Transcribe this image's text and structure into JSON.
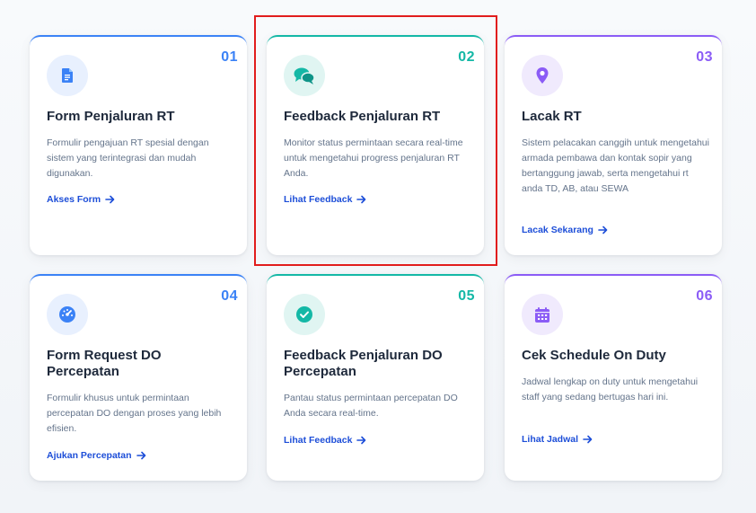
{
  "cards": [
    {
      "number": "01",
      "icon": "document-icon",
      "title": "Form Penjaluran RT",
      "description": "Formulir pengajuan RT spesial dengan sistem yang terintegrasi dan mudah digunakan.",
      "link": "Akses Form",
      "accent": "#3b82f6"
    },
    {
      "number": "02",
      "icon": "chat-bubbles-icon",
      "title": "Feedback Penjaluran RT",
      "description": "Monitor status permintaan secara real-time untuk mengetahui progress penjaluran RT Anda.",
      "link": "Lihat Feedback",
      "accent": "#14b8a6"
    },
    {
      "number": "03",
      "icon": "map-pin-icon",
      "title": "Lacak RT",
      "description": "Sistem pelacakan canggih untuk mengetahui armada pembawa dan kontak sopir yang bertanggung jawab, serta mengetahui rt anda TD, AB, atau SEWA",
      "link": "Lacak Sekarang",
      "accent": "#8b5cf6"
    },
    {
      "number": "04",
      "icon": "speedometer-icon",
      "title": "Form Request DO Percepatan",
      "description": "Formulir khusus untuk permintaan percepatan DO dengan proses yang lebih efisien.",
      "link": "Ajukan Percepatan",
      "accent": "#3b82f6"
    },
    {
      "number": "05",
      "icon": "check-circle-icon",
      "title": "Feedback Penjaluran DO Percepatan",
      "description": "Pantau status permintaan percepatan DO Anda secara real-time.",
      "link": "Lihat Feedback",
      "accent": "#14b8a6"
    },
    {
      "number": "06",
      "icon": "calendar-icon",
      "title": "Cek Schedule On Duty",
      "description": "Jadwal lengkap on duty untuk mengetahui staff yang sedang bertugas hari ini.",
      "link": "Lihat Jadwal",
      "accent": "#8b5cf6"
    }
  ],
  "link_color": "#1d4ed8",
  "highlight_color": "#e11d1d"
}
